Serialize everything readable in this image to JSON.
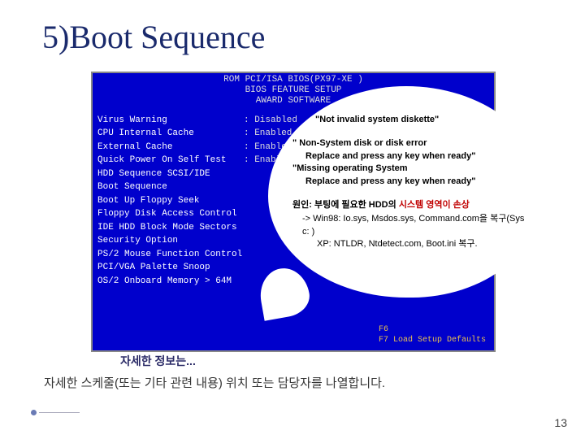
{
  "title": "5)Boot Sequence",
  "bios": {
    "header_lines": [
      "ROM PCI/ISA BIOS(PX97-XE )",
      "BIOS FEATURE SETUP",
      "AWARD SOFTWARE"
    ],
    "items": [
      {
        "label": "Virus Warning",
        "value": ": Disabled"
      },
      {
        "label": "CPU Internal Cache",
        "value": ": Enabled"
      },
      {
        "label": "External Cache",
        "value": ": Enabled"
      },
      {
        "label": "Quick Power On Self Test",
        "value": ": Enabled"
      },
      {
        "label": "HDD Sequence SCSI/IDE",
        "value": ""
      },
      {
        "label": "Boot Sequence",
        "value": ""
      },
      {
        "label": "Boot Up Floppy Seek",
        "value": ""
      },
      {
        "label": "Floppy Disk Access Control",
        "value": ""
      },
      {
        "label": "IDE HDD Block Mode Sectors",
        "value": ""
      },
      {
        "label": "Security Option",
        "value": ""
      },
      {
        "label": "PS/2 Mouse Function Control",
        "value": ""
      },
      {
        "label": "PCI/VGA Palette Snoop",
        "value": ""
      },
      {
        "label": "OS/2 Onboard Memory > 64M",
        "value": ""
      }
    ],
    "footer_lines": [
      "F6",
      "F7    Load Setup Defaults"
    ]
  },
  "bubble": {
    "msg1": "\"Not invalid system diskette\"",
    "msg2_l1": "\" Non-System disk or disk error",
    "msg2_l2": "Replace and press any key when ready\"",
    "msg2_l3": "\"Missing operating System",
    "msg2_l4": "Replace and press any key when ready\"",
    "cause_prefix": "원인: 부팅에 필요한 HDD의 ",
    "cause_highlight": "시스템 영역이 손상",
    "fix_l1": "-> Win98: Io.sys, Msdos.sys, Command.com을 복구(Sys c: )",
    "fix_l2": "XP: NTLDR, Ntdetect.com, Boot.ini 복구."
  },
  "info_link": "자세한 정보는...",
  "footer_text": "자세한 스케줄(또는 기타 관련 내용) 위치 또는 담당자를 나열합니다.",
  "page_number": "13"
}
